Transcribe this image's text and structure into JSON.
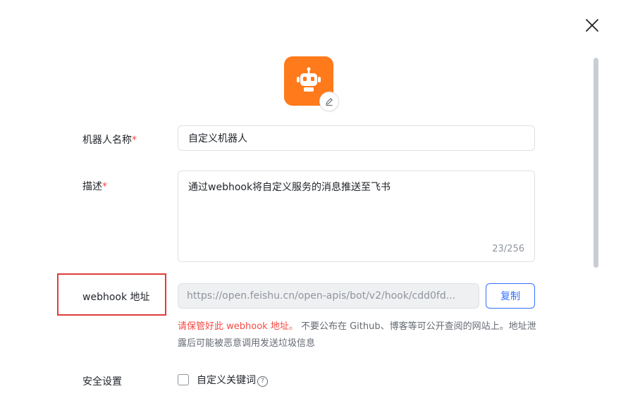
{
  "dialog": {
    "close_icon": "close-icon",
    "avatar": {
      "icon": "robot-icon",
      "edit_icon": "pencil-icon",
      "bg": "#ff7a1a"
    }
  },
  "form": {
    "name": {
      "label": "机器人名称",
      "required_mark": "*",
      "value": "自定义机器人"
    },
    "description": {
      "label": "描述",
      "required_mark": "*",
      "value": "通过webhook将自定义服务的消息推送至飞书",
      "counter": "23/256"
    },
    "webhook": {
      "label": "webhook 地址",
      "url": "https://open.feishu.cn/open-apis/bot/v2/hook/cdd0fd...",
      "copy_label": "复制",
      "warning_red": "请保管好此 webhook 地址。",
      "warning_rest": " 不要公布在 Github、博客等可公开查阅的网站上。地址泄露后可能被恶意调用发送垃圾信息"
    },
    "security": {
      "label": "安全设置",
      "option_label": "自定义关键词",
      "help_icon": "question-circle-icon"
    }
  },
  "colors": {
    "accent": "#3370ff",
    "danger": "#f54a45",
    "highlight_box": "#e03b3b"
  }
}
